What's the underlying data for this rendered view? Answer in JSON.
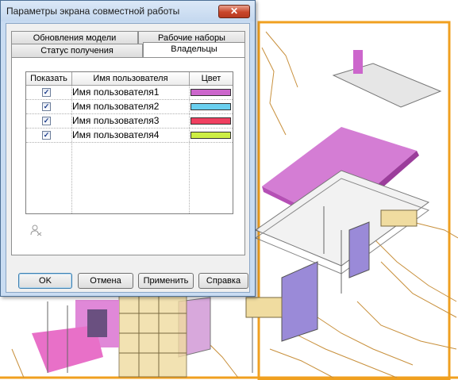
{
  "dialog": {
    "title": "Параметры экрана совместной работы",
    "close_glyph": "✕",
    "tabs": {
      "row_back": [
        "Обновления модели",
        "Рабочие наборы"
      ],
      "row_front": [
        "Статус получения",
        "Владельцы"
      ],
      "active": "Владельцы"
    },
    "grid": {
      "headers": [
        "Показать",
        "Имя пользователя",
        "Цвет"
      ],
      "rows": [
        {
          "show": true,
          "user": "Имя пользователя1",
          "color": "#cc66cc"
        },
        {
          "show": true,
          "user": "Имя пользователя2",
          "color": "#6ad0f0"
        },
        {
          "show": true,
          "user": "Имя пользователя3",
          "color": "#f04060"
        },
        {
          "show": true,
          "user": "Имя пользователя4",
          "color": "#ccee44"
        }
      ],
      "check_glyph": "✓"
    },
    "user_icon": "user-settings-icon",
    "buttons": {
      "ok": "OK",
      "cancel": "Отмена",
      "apply": "Применить",
      "help": "Справка"
    }
  },
  "viewport": {
    "frame_color": "#f0a020",
    "owner_color": "#cc66cc",
    "wall_color": "#9a8ad8"
  }
}
